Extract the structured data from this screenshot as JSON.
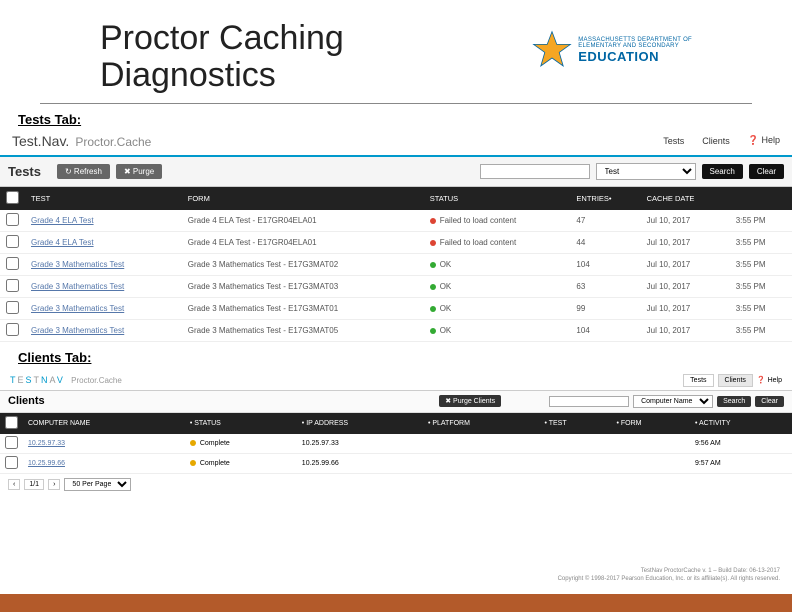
{
  "header": {
    "title_line1": "Proctor Caching",
    "title_line2": "Diagnostics",
    "logo_line1": "MASSACHUSETTS DEPARTMENT OF",
    "logo_line2": "ELEMENTARY AND SECONDARY",
    "logo_line3": "EDUCATION"
  },
  "tests_section": {
    "label": "Tests Tab:",
    "brand_tn": "Test.Nav.",
    "brand_pc": "Proctor.Cache",
    "nav": {
      "tests": "Tests",
      "clients": "Clients",
      "help": "Help"
    },
    "toolbar": {
      "title": "Tests",
      "refresh": "↻ Refresh",
      "purge": "✖ Purge",
      "dropdown": "Test",
      "search": "Search",
      "clear": "Clear"
    },
    "columns": [
      "",
      "TEST",
      "FORM",
      "STATUS",
      "ENTRIES•",
      "CACHE DATE",
      ""
    ],
    "rows": [
      {
        "test": "Grade 4 ELA Test",
        "form": "Grade 4 ELA Test - E17GR04ELA01",
        "status": "Failed to load content",
        "status_color": "red",
        "entries": "47",
        "date": "Jul 10, 2017",
        "time": "3:55 PM"
      },
      {
        "test": "Grade 4 ELA Test",
        "form": "Grade 4 ELA Test - E17GR04ELA01",
        "status": "Failed to load content",
        "status_color": "red",
        "entries": "44",
        "date": "Jul 10, 2017",
        "time": "3:55 PM"
      },
      {
        "test": "Grade 3 Mathematics Test",
        "form": "Grade 3 Mathematics Test - E17G3MAT02",
        "status": "OK",
        "status_color": "green",
        "entries": "104",
        "date": "Jul 10, 2017",
        "time": "3:55 PM"
      },
      {
        "test": "Grade 3 Mathematics Test",
        "form": "Grade 3 Mathematics Test - E17G3MAT03",
        "status": "OK",
        "status_color": "green",
        "entries": "63",
        "date": "Jul 10, 2017",
        "time": "3:55 PM"
      },
      {
        "test": "Grade 3 Mathematics Test",
        "form": "Grade 3 Mathematics Test - E17G3MAT01",
        "status": "OK",
        "status_color": "green",
        "entries": "99",
        "date": "Jul 10, 2017",
        "time": "3:55 PM"
      },
      {
        "test": "Grade 3 Mathematics Test",
        "form": "Grade 3 Mathematics Test - E17G3MAT05",
        "status": "OK",
        "status_color": "green",
        "entries": "104",
        "date": "Jul 10, 2017",
        "time": "3:55 PM"
      }
    ]
  },
  "clients_section": {
    "label": "Clients Tab:",
    "brand": "TESTNAV",
    "brand_pc": "Proctor.Cache",
    "nav": {
      "tests": "Tests",
      "clients": "Clients",
      "help": "Help"
    },
    "toolbar": {
      "title": "Clients",
      "purge": "✖ Purge Clients",
      "dropdown": "Computer Name",
      "search": "Search",
      "clear": "Clear"
    },
    "columns": [
      "",
      "COMPUTER NAME",
      "• STATUS",
      "• IP ADDRESS",
      "• PLATFORM",
      "• TEST",
      "• FORM",
      "• ACTIVITY"
    ],
    "rows": [
      {
        "name": "10.25.97.33",
        "status": "Complete",
        "ip": "10.25.97.33",
        "platform": "",
        "test": "",
        "form": "",
        "activity": "9:56 AM"
      },
      {
        "name": "10.25.99.66",
        "status": "Complete",
        "ip": "10.25.99.66",
        "platform": "",
        "test": "",
        "form": "",
        "activity": "9:57 AM"
      }
    ],
    "pager": {
      "page": "1/1",
      "per_page": "50 Per Page"
    },
    "footer1": "TestNav ProctorCache v. 1 – Build Date: 06-13-2017",
    "footer2": "Copyright © 1998-2017 Pearson Education, Inc. or its affiliate(s). All rights reserved."
  }
}
